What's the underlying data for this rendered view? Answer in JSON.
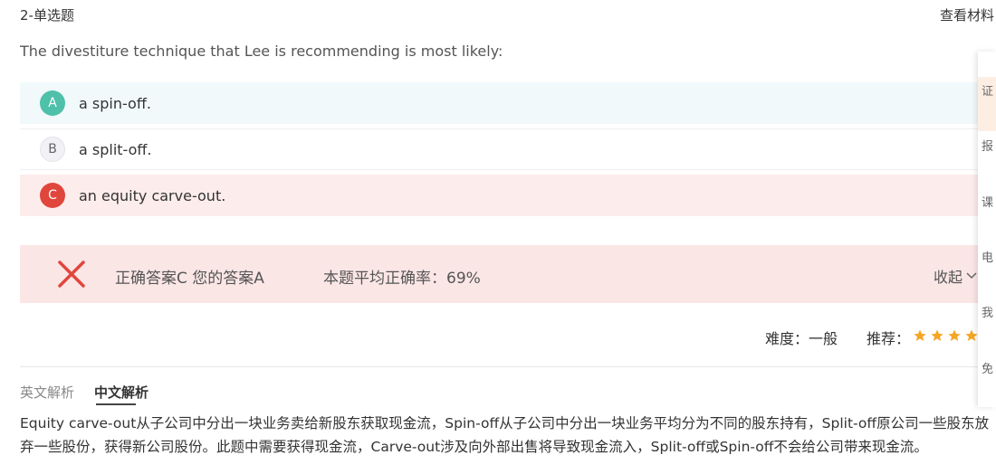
{
  "header": {
    "question_type": "2-单选题",
    "view_material": "查看材料"
  },
  "question": {
    "stem": "The divestiture technique that Lee is recommending is most likely:"
  },
  "options": [
    {
      "letter": "A",
      "text": "a spin-off."
    },
    {
      "letter": "B",
      "text": "a split-off."
    },
    {
      "letter": "C",
      "text": "an equity carve-out."
    }
  ],
  "result": {
    "answer_text": "正确答案C 您的答案A",
    "rate_text": "本题平均正确率：69%",
    "collapse_label": "收起"
  },
  "meta": {
    "difficulty": "难度：一般",
    "recommend_label": "推荐：",
    "recommend_stars": 4
  },
  "tabs": {
    "english": "英文解析",
    "chinese": "中文解析"
  },
  "analysis": "Equity carve-out从子公司中分出一块业务卖给新股东获取现金流，Spin-off从子公司中分出一块业务平均分为不同的股东持有，Split-off原公司一些股东放弃一些股份，获得新公司股份。此题中需要获得现金流，Carve-out涉及向外部出售将导致现金流入，Split-off或Spin-off不会给公司带来现金流。",
  "sidebar": {
    "items": [
      "证",
      "报",
      "课",
      "电",
      "我",
      "免"
    ]
  },
  "colors": {
    "correct": "#4fc0a9",
    "wrong": "#e0463c",
    "star": "#f5a623",
    "result_bg": "#fbe6e6"
  }
}
